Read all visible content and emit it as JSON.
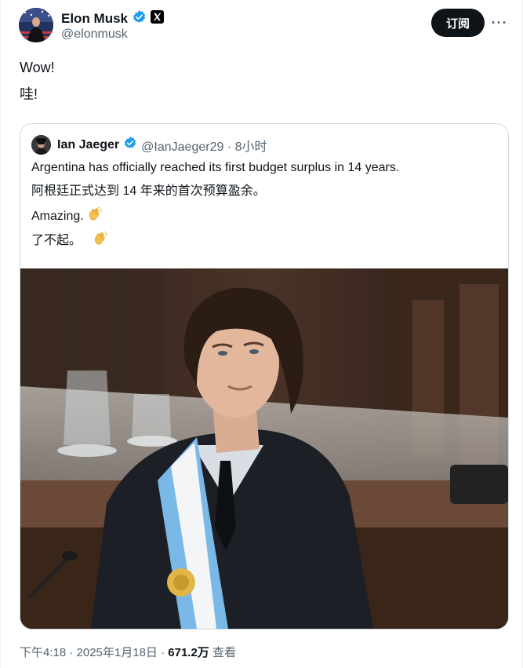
{
  "author": {
    "name": "Elon Musk",
    "handle": "@elonmusk",
    "verified_icon": "verified-badge-icon",
    "affiliation_icon": "x-logo-icon"
  },
  "actions": {
    "subscribe_label": "订阅",
    "more_label": "···"
  },
  "post": {
    "line1": "Wow!",
    "line2": "哇!"
  },
  "quote": {
    "name": "Ian Jaeger",
    "handle_time": "@IanJaeger29 · 8小时",
    "line1": "Argentina has officially reached its first budget surplus in 14 years.",
    "line2": "阿根廷正式达到 14 年来的首次预算盈余。",
    "line3": "Amazing.",
    "line4": "了不起。",
    "emoji_icon": "clapping-hands-icon",
    "image_alt": "man wearing presidential sash looking upward"
  },
  "footer": {
    "time": "下午4:18 · 2025年1月18日 · ",
    "views": "671.2万",
    "views_label": " 查看"
  },
  "colors": {
    "verified": "#1d9bf0",
    "text": "#0f1419",
    "muted": "#536471",
    "border": "#cfd9de"
  }
}
